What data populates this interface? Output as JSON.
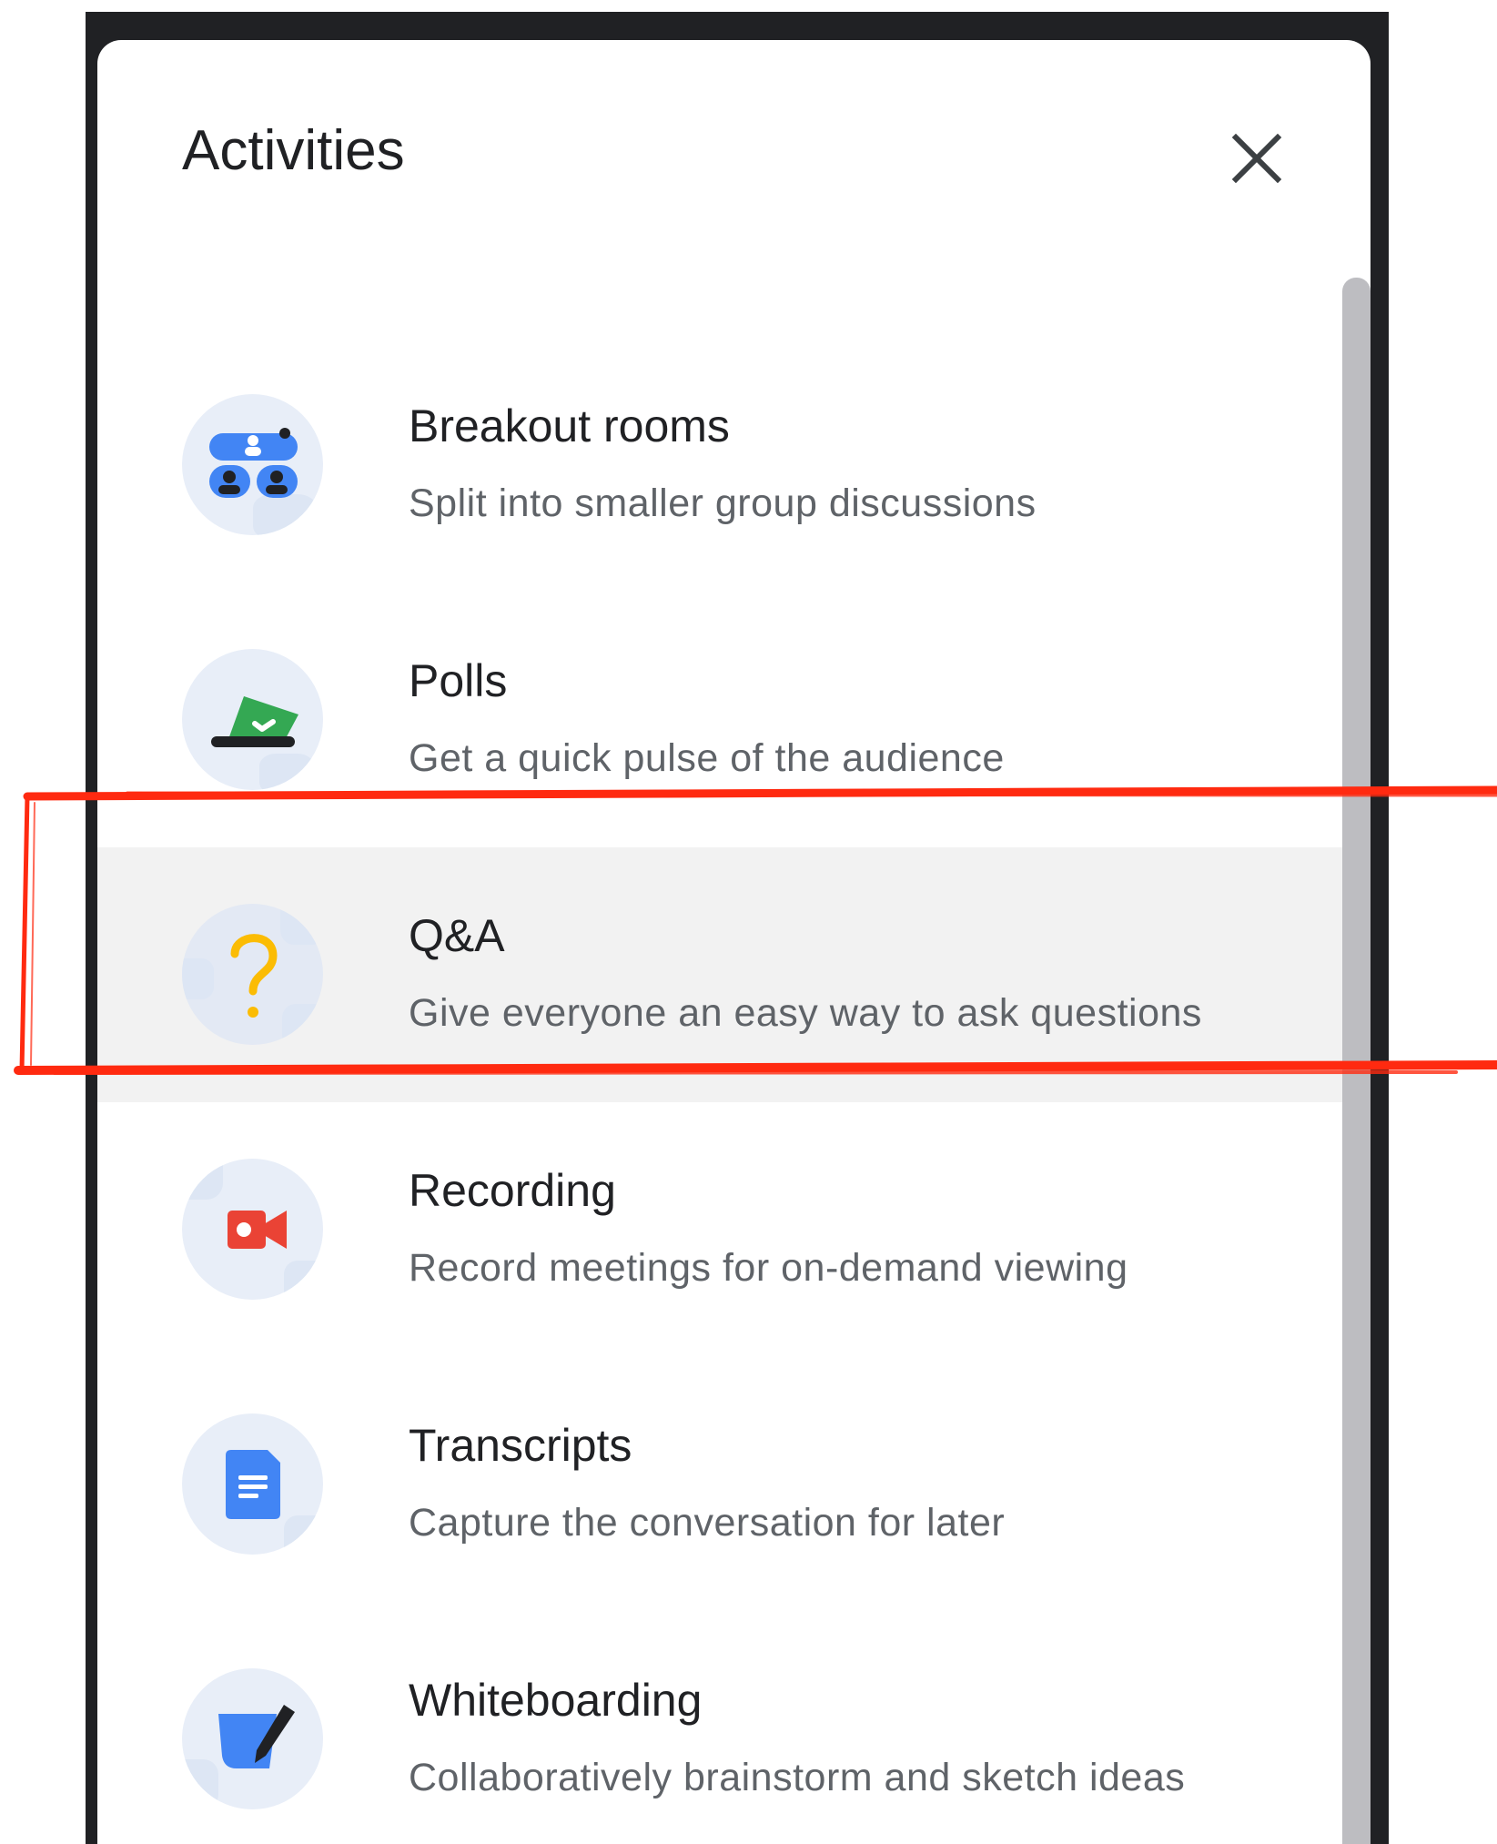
{
  "panel": {
    "title": "Activities",
    "close_label": "Close"
  },
  "items": [
    {
      "title": "Breakout rooms",
      "description": "Split into smaller group discussions",
      "icon": "breakout-rooms-icon"
    },
    {
      "title": "Polls",
      "description": "Get a quick pulse of the audience",
      "icon": "polls-icon"
    },
    {
      "title": "Q&A",
      "description": "Give everyone an easy way to ask questions",
      "icon": "qa-icon",
      "highlighted": true
    },
    {
      "title": "Recording",
      "description": "Record meetings for on-demand viewing",
      "icon": "recording-icon"
    },
    {
      "title": "Transcripts",
      "description": "Capture the conversation for later",
      "icon": "transcripts-icon"
    },
    {
      "title": "Whiteboarding",
      "description": "Collaboratively brainstorm and sketch ideas",
      "icon": "whiteboarding-icon"
    }
  ],
  "colors": {
    "frame": "#202124",
    "highlight": "#f2f2f2",
    "annotation": "#ff2a10",
    "icon_bg": "#e8eef8",
    "blue": "#4285f4",
    "green": "#34a853",
    "yellow": "#fbbc04",
    "red": "#ea4335"
  }
}
